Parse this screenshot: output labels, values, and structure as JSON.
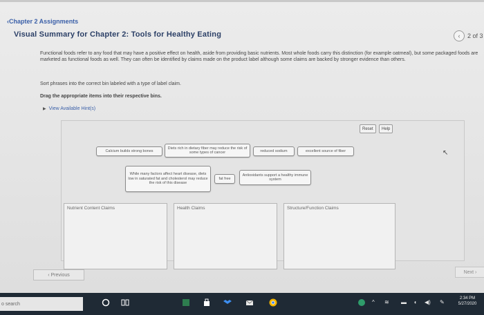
{
  "header": {
    "back_link": "‹Chapter 2 Assignments",
    "title": "Visual Summary for Chapter 2: Tools for Healthy Eating",
    "pager_text": "2 of 3"
  },
  "content": {
    "paragraph": "Functional foods refer to any food that may have a positive effect on health, aside from providing basic nutrients. Most whole foods carry this distinction (for example oatmeal), but some packaged foods are marketed as functional foods as well. They can often be identified by claims made on the product label although some claims are backed by stronger evidence than others.",
    "instruction_sort": "Sort phrases into the correct bin labeled with a type of label claim.",
    "instruction_drag": "Drag the appropriate items into their respective bins.",
    "hints_link": "View Available Hint(s)"
  },
  "toolbar": {
    "reset_label": "Reset",
    "help_label": "Help"
  },
  "chips": [
    "Calcium builds strong bones",
    "Diets rich in dietary fiber may reduce the risk of some types of cancer",
    "reduced sodium",
    "excellent source of fiber",
    "While many factors affect heart disease, diets low in saturated fat and cholesterol may reduce the risk of this disease",
    "fat free",
    "Antioxidants support a healthy immune system"
  ],
  "bins": [
    {
      "label": "Nutrient Content Claims"
    },
    {
      "label": "Health Claims"
    },
    {
      "label": "Structure/Function Claims"
    }
  ],
  "nav": {
    "previous_label": "‹ Previous",
    "next_label": "Next ›"
  },
  "taskbar": {
    "search_text": "o search",
    "time": "2:34 PM",
    "date": "5/27/2020"
  },
  "colors": {
    "link": "#3a5fa8",
    "title": "#2b3f66",
    "taskbar": "#1f2a35"
  }
}
